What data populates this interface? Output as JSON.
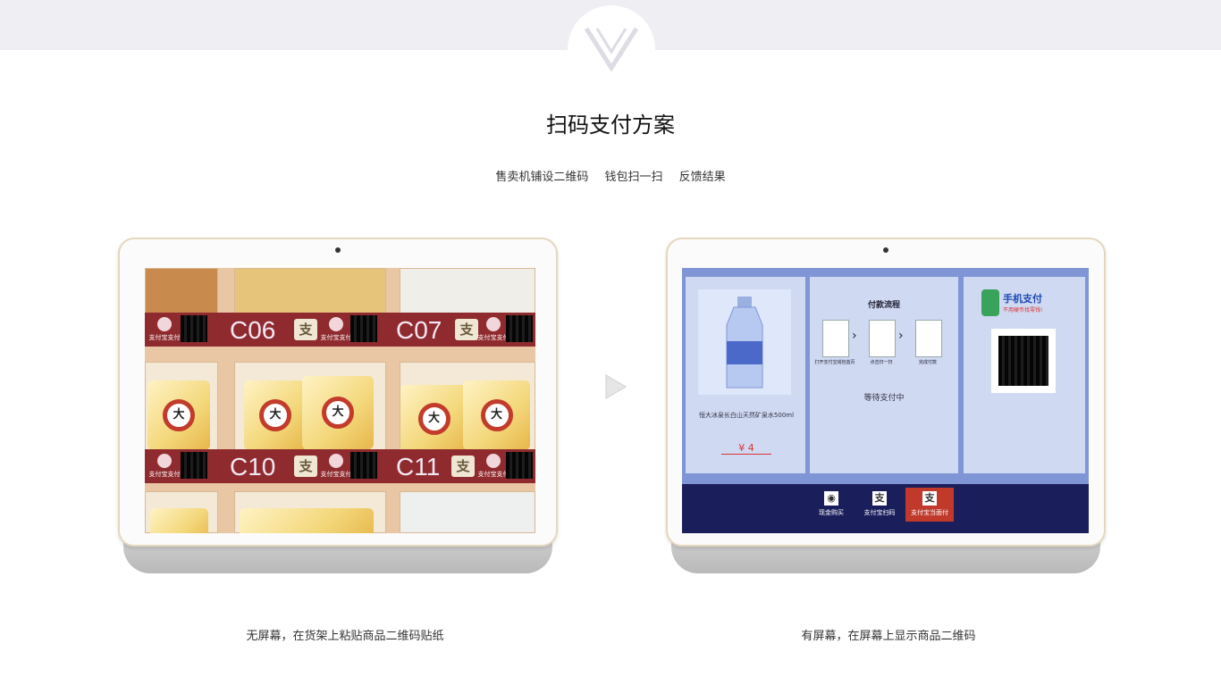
{
  "header": {
    "title": "扫码支付方案"
  },
  "steps": [
    "售卖机铺设二维码",
    "钱包扫一扫",
    "反馈结果"
  ],
  "left_panel": {
    "caption": "无屏幕，在货架上粘贴商品二维码贴纸",
    "labels": [
      "C06",
      "C07",
      "C10",
      "C11"
    ],
    "pay_icon": "支",
    "badge_text": "支付宝支付",
    "product_text": "大"
  },
  "right_panel": {
    "caption": "有屏幕，在屏幕上显示商品二维码",
    "product_name": "恒大冰泉长白山天然矿泉水500ml",
    "price": "¥ 4",
    "flow_title": "付款流程",
    "flow_steps": [
      "打开支付宝钱包首页",
      "点击扫一扫",
      "完成付款"
    ],
    "waiting": "等待支付中",
    "mobile_pay_title": "手机支付",
    "mobile_pay_sub": "不用硬币找零钱!",
    "nav": [
      "现金购买",
      "支付宝扫码",
      "支付宝当面付"
    ]
  },
  "colors": {
    "accent_red": "#8f2b2f",
    "nav_bg": "#1a1f5c",
    "active_nav": "#c0392b"
  }
}
